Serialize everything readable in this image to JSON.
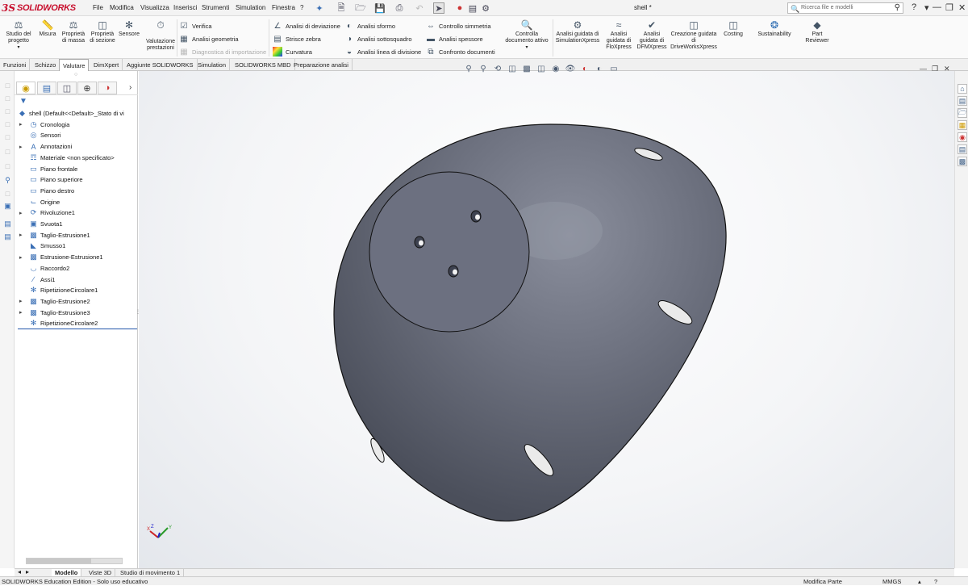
{
  "app": {
    "logo_ds": "3S",
    "logo_text": "SOLIDWORKS",
    "doc_title": "shell *"
  },
  "menu": [
    "File",
    "Modifica",
    "Visualizza",
    "Inserisci",
    "Strumenti",
    "Simulation",
    "Finestra",
    "?"
  ],
  "search": {
    "placeholder": "Ricerca file e modelli"
  },
  "ribbon": {
    "big_buttons": [
      {
        "label": "Studio del progetto",
        "icon": "design-study-icon"
      },
      {
        "label": "Misura",
        "icon": "measure-icon"
      },
      {
        "label": "Proprietà di massa",
        "icon": "mass-properties-icon"
      },
      {
        "label": "Proprietà di sezione",
        "icon": "section-properties-icon"
      },
      {
        "label": "Sensore",
        "icon": "sensor-icon"
      },
      {
        "label": "Valutazione prestazioni",
        "icon": "performance-evaluation-icon"
      },
      {
        "label": "Controlla documento attivo",
        "icon": "check-document-icon"
      },
      {
        "label": "Analisi guidata di SimulationXpress",
        "icon": "simulationxpress-icon"
      },
      {
        "label": "Analisi guidata di FloXpress",
        "icon": "floxpress-icon"
      },
      {
        "label": "Analisi guidata di DFMXpress",
        "icon": "dfmxpress-icon"
      },
      {
        "label": "Creazione guidata di DriveWorksXpress",
        "icon": "driveworksxpress-icon"
      },
      {
        "label": "Costing",
        "icon": "costing-icon"
      },
      {
        "label": "Sustainability",
        "icon": "sustainability-icon"
      },
      {
        "label": "Part Reviewer",
        "icon": "part-reviewer-icon"
      }
    ],
    "small_buttons": [
      {
        "label": "Verifica",
        "disabled": false
      },
      {
        "label": "Analisi geometria",
        "disabled": false
      },
      {
        "label": "Diagnostica di importazione",
        "disabled": true
      },
      {
        "label": "Analisi di deviazione",
        "disabled": false
      },
      {
        "label": "Strisce zebra",
        "disabled": false
      },
      {
        "label": "Curvatura",
        "disabled": false
      },
      {
        "label": "Analisi sformo",
        "disabled": false
      },
      {
        "label": "Analisi sottosquadro",
        "disabled": false
      },
      {
        "label": "Analisi linea di divisione",
        "disabled": false
      },
      {
        "label": "Controllo simmetria",
        "disabled": false
      },
      {
        "label": "Analisi spessore",
        "disabled": false
      },
      {
        "label": "Confronto documenti",
        "disabled": false
      }
    ]
  },
  "command_tabs": [
    "Funzioni",
    "Schizzo",
    "Valutare",
    "DimXpert",
    "Aggiunte SOLIDWORKS",
    "Simulation",
    "SOLIDWORKS MBD",
    "Preparazione analisi"
  ],
  "active_command_tab": "Valutare",
  "feature_tree": [
    {
      "label": "shell  (Default<<Default>_Stato di vi",
      "icon": "part-icon",
      "expandable": false
    },
    {
      "label": "Cronologia",
      "icon": "history-icon",
      "expandable": true
    },
    {
      "label": "Sensori",
      "icon": "sensors-icon",
      "expandable": false
    },
    {
      "label": "Annotazioni",
      "icon": "annotations-icon",
      "expandable": true
    },
    {
      "label": "Materiale <non specificato>",
      "icon": "material-icon",
      "expandable": false
    },
    {
      "label": "Piano frontale",
      "icon": "plane-icon",
      "expandable": false
    },
    {
      "label": "Piano superiore",
      "icon": "plane-icon",
      "expandable": false
    },
    {
      "label": "Piano destro",
      "icon": "plane-icon",
      "expandable": false
    },
    {
      "label": "Origine",
      "icon": "origin-icon",
      "expandable": false
    },
    {
      "label": "Rivoluzione1",
      "icon": "revolve-icon",
      "expandable": true
    },
    {
      "label": "Svuota1",
      "icon": "shell-feature-icon",
      "expandable": false
    },
    {
      "label": "Taglio-Estrusione1",
      "icon": "cut-extrude-icon",
      "expandable": true
    },
    {
      "label": "Smusso1",
      "icon": "chamfer-icon",
      "expandable": false
    },
    {
      "label": "Estrusione-Estrusione1",
      "icon": "boss-extrude-icon",
      "expandable": true
    },
    {
      "label": "Raccordo2",
      "icon": "fillet-icon",
      "expandable": false
    },
    {
      "label": "Assi1",
      "icon": "axis-icon",
      "expandable": false
    },
    {
      "label": "RipetizioneCircolare1",
      "icon": "circular-pattern-icon",
      "expandable": false
    },
    {
      "label": "Taglio-Estrusione2",
      "icon": "cut-extrude-icon",
      "expandable": true
    },
    {
      "label": "Taglio-Estrusione3",
      "icon": "cut-extrude-icon",
      "expandable": true
    },
    {
      "label": "RipetizioneCircolare2",
      "icon": "circular-pattern-icon",
      "expandable": false
    }
  ],
  "bottom_tabs": [
    "Modello",
    "Viste 3D",
    "Studio di movimento 1"
  ],
  "active_bottom_tab": "Modello",
  "status": {
    "left": "SOLIDWORKS Education Edition - Solo uso educativo",
    "mode": "Modifica Parte",
    "units": "MMGS"
  },
  "triad": {
    "x": "X",
    "y": "Y",
    "z": "Z"
  },
  "colors": {
    "brand": "#c8102e",
    "model": "#6b6f7d",
    "accent": "#3a6fb5"
  }
}
